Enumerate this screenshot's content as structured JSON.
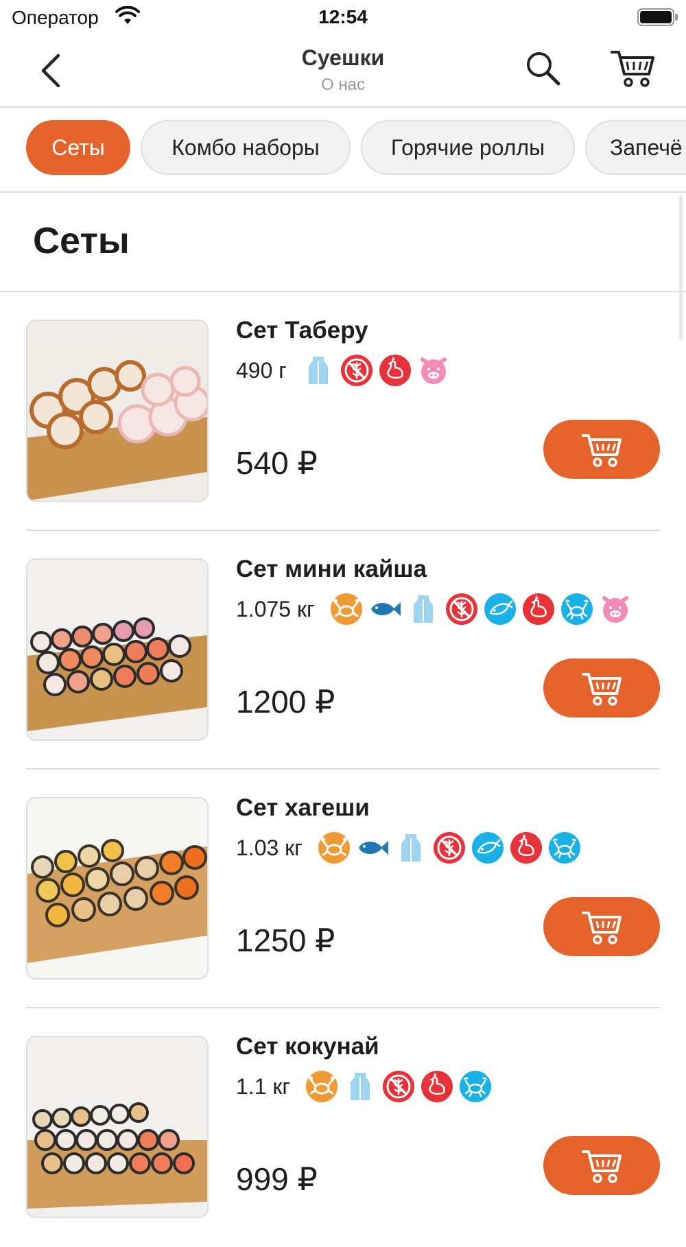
{
  "status_bar": {
    "carrier": "Оператор",
    "time": "12:54"
  },
  "nav": {
    "title": "Суешки",
    "subtitle": "О нас",
    "icons": [
      "chevron-left-icon",
      "search-icon",
      "cart-icon"
    ]
  },
  "categories": [
    {
      "label": "Сеты",
      "active": true
    },
    {
      "label": "Комбо наборы",
      "active": false
    },
    {
      "label": "Горячие роллы",
      "active": false
    },
    {
      "label": "Запечё",
      "active": false
    }
  ],
  "section": {
    "title": "Сеты"
  },
  "colors": {
    "accent": "#e5622b",
    "crab": "#ef9a32",
    "fish": "#1f78b4",
    "milk": "#9dd4ef",
    "no_gluten": "#e63238",
    "chicken": "#e63238",
    "seafood": "#1ab1e6",
    "pork": "#f48bb6"
  },
  "products": [
    {
      "name": "Сет Таберу",
      "weight": "490 г",
      "price": "540 ₽",
      "badges": [
        "milk-icon",
        "gluten-free-icon",
        "chicken-icon",
        "pork-icon"
      ]
    },
    {
      "name": "Сет мини кайша",
      "weight": "1.075 кг",
      "price": "1200 ₽",
      "badges": [
        "crab-icon",
        "fish-icon",
        "milk-icon",
        "gluten-free-icon",
        "fish-badge-icon",
        "chicken-icon",
        "seafood-icon",
        "pork-icon"
      ]
    },
    {
      "name": "Сет хагеши",
      "weight": "1.03 кг",
      "price": "1250 ₽",
      "badges": [
        "crab-icon",
        "fish-icon",
        "milk-icon",
        "gluten-free-icon",
        "fish-badge-icon",
        "chicken-icon",
        "seafood-icon"
      ]
    },
    {
      "name": "Сет кокунай",
      "weight": "1.1 кг",
      "price": "999 ₽",
      "badges": [
        "crab-icon",
        "milk-icon",
        "gluten-free-icon",
        "chicken-icon",
        "seafood-icon"
      ]
    }
  ]
}
